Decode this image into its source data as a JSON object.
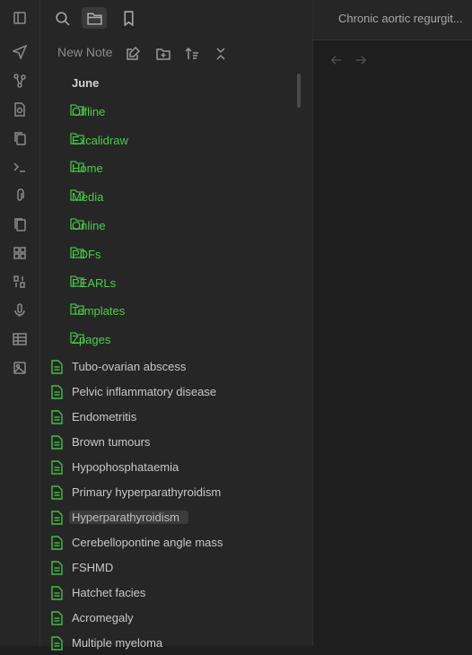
{
  "ribbon": {
    "icons": [
      "sidebar-toggle-icon",
      "send-icon",
      "graph-icon",
      "file-search-icon",
      "copy-icon",
      "terminal-icon",
      "paperclip-icon",
      "cards-icon",
      "grid-icon",
      "binary-icon",
      "microphone-icon",
      "table-icon",
      "image-icon"
    ]
  },
  "sidebar": {
    "tabs": [
      "search-icon",
      "folder-icon",
      "bookmark-icon"
    ],
    "new_note_label": "New Note",
    "folders": [
      "June",
      "Offline",
      "Excalidraw",
      "Home",
      "Media",
      "Online",
      "PDFs",
      "PEARLs",
      "Templates",
      "Zpages"
    ],
    "files": [
      "Tubo-ovarian abscess",
      "Pelvic inflammatory disease",
      "Endometritis",
      "Brown tumours",
      "Hypophosphataemia",
      "Primary hyperparathyroidism",
      "Hyperparathyroidism",
      "Cerebellopontine angle mass",
      "FSHMD",
      "Hatchet facies",
      "Acromegaly",
      "Multiple myeloma"
    ],
    "selected_file": "Hyperparathyroidism"
  },
  "main": {
    "tab_title": "Chronic aortic regurgit..."
  },
  "colors": {
    "accent_green": "#45d145",
    "background": "#1e1e1e",
    "sidebar_bg": "#262626"
  }
}
